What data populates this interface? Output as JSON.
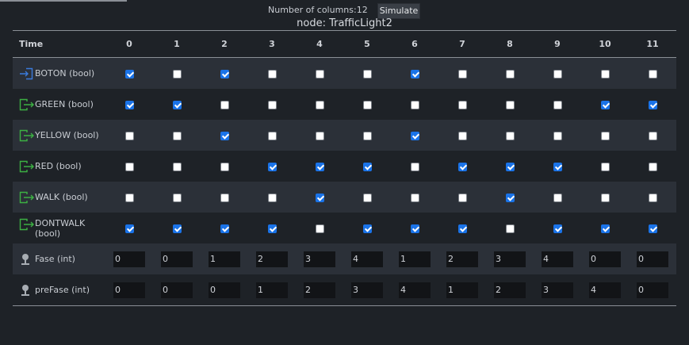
{
  "toolbar": {
    "columns_label": "Number of columns:12",
    "simulate_label": "Simulate"
  },
  "node_title": "node: TrafficLight2",
  "table": {
    "time_header": "Time",
    "columns": [
      "0",
      "1",
      "2",
      "3",
      "4",
      "5",
      "6",
      "7",
      "8",
      "9",
      "10",
      "11"
    ],
    "rows": [
      {
        "label": "BOTON (bool)",
        "icon": "input-icon",
        "color": "#3b7bdc",
        "type": "bool",
        "values": [
          true,
          false,
          true,
          false,
          false,
          false,
          true,
          false,
          false,
          false,
          false,
          false
        ]
      },
      {
        "label": "GREEN (bool)",
        "icon": "output-icon",
        "color": "#3cb043",
        "type": "bool",
        "values": [
          true,
          true,
          false,
          false,
          false,
          false,
          false,
          false,
          false,
          false,
          true,
          true
        ]
      },
      {
        "label": "YELLOW (bool)",
        "icon": "output-icon",
        "color": "#3cb043",
        "type": "bool",
        "values": [
          false,
          false,
          true,
          false,
          false,
          false,
          true,
          false,
          false,
          false,
          false,
          false
        ]
      },
      {
        "label": "RED (bool)",
        "icon": "output-icon",
        "color": "#3cb043",
        "type": "bool",
        "values": [
          false,
          false,
          false,
          true,
          true,
          true,
          false,
          true,
          true,
          true,
          false,
          false
        ]
      },
      {
        "label": "WALK (bool)",
        "icon": "output-icon",
        "color": "#3cb043",
        "type": "bool",
        "values": [
          false,
          false,
          false,
          false,
          true,
          false,
          false,
          false,
          true,
          false,
          false,
          false
        ]
      },
      {
        "label": "DONTWALK (bool)",
        "icon": "output-icon",
        "color": "#3cb043",
        "type": "bool",
        "values": [
          true,
          true,
          true,
          true,
          false,
          true,
          true,
          true,
          false,
          true,
          true,
          true
        ]
      },
      {
        "label": "Fase (int)",
        "icon": "local-variable-icon",
        "color": "#a8adb3",
        "type": "int",
        "values": [
          "0",
          "0",
          "1",
          "2",
          "3",
          "4",
          "1",
          "2",
          "3",
          "4",
          "0",
          "0"
        ]
      },
      {
        "label": "preFase (int)",
        "icon": "local-variable-icon",
        "color": "#a8adb3",
        "type": "int",
        "values": [
          "0",
          "0",
          "0",
          "1",
          "2",
          "3",
          "4",
          "1",
          "2",
          "3",
          "4",
          "0"
        ]
      }
    ]
  }
}
